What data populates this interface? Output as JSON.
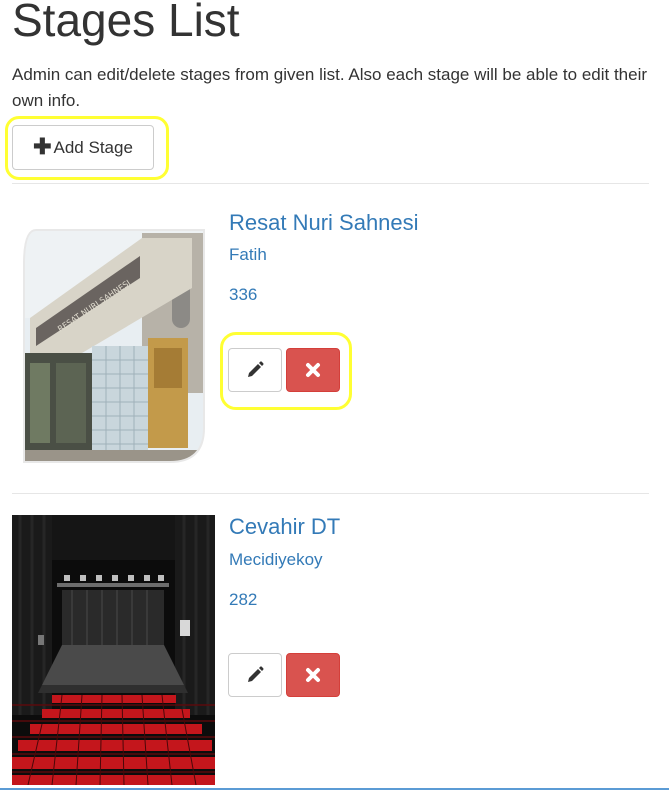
{
  "header": {
    "title": "Stages List",
    "description": "Admin can edit/delete stages from given list. Also each stage will be able to edit their own info."
  },
  "toolbar": {
    "add_icon": "plus-icon",
    "add_label": "Add Stage"
  },
  "stages": [
    {
      "name": "Resat Nuri Sahnesi",
      "location": "Fatih",
      "capacity": "336",
      "image": "building-facade-photo",
      "edit_icon": "pencil-icon",
      "delete_icon": "times-icon"
    },
    {
      "name": "Cevahir DT",
      "location": "Mecidiyekoy",
      "capacity": "282",
      "image": "theater-auditorium-photo",
      "edit_icon": "pencil-icon",
      "delete_icon": "times-icon"
    }
  ],
  "colors": {
    "link": "#337ab7",
    "danger": "#d9534f",
    "highlight": "#ffff33"
  }
}
